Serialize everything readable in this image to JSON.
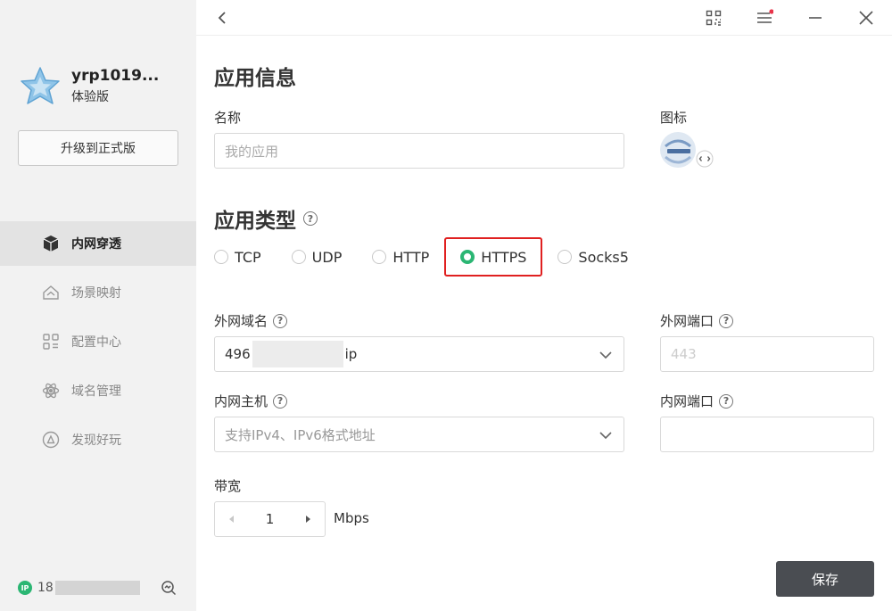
{
  "sidebar": {
    "profile": {
      "username": "yrp1019...",
      "edition": "体验版"
    },
    "upgrade_label": "升级到正式版",
    "items": [
      {
        "label": "内网穿透",
        "icon": "cube-icon",
        "active": true
      },
      {
        "label": "场景映射",
        "icon": "house-icon",
        "active": false
      },
      {
        "label": "配置中心",
        "icon": "grid-icon",
        "active": false
      },
      {
        "label": "域名管理",
        "icon": "atom-icon",
        "active": false
      },
      {
        "label": "发现好玩",
        "icon": "discover-icon",
        "active": false
      }
    ],
    "footer": {
      "ip_badge": "IP",
      "ip_prefix": "18"
    }
  },
  "topbar": {
    "icons": [
      "back-icon",
      "qr-code-icon",
      "menu-icon",
      "minimize-icon",
      "close-icon"
    ],
    "notification_dot_color": "#e8334a"
  },
  "app_info": {
    "title": "应用信息",
    "name_label": "名称",
    "name_placeholder": "我的应用",
    "icon_label": "图标"
  },
  "app_type": {
    "title": "应用类型",
    "help": "?",
    "options": [
      "TCP",
      "UDP",
      "HTTP",
      "HTTPS",
      "Socks5"
    ],
    "selected": "HTTPS"
  },
  "fields": {
    "external_domain": {
      "label": "外网域名",
      "value_prefix": "496",
      "value_suffix": "ip"
    },
    "external_port": {
      "label": "外网端口",
      "placeholder": "443"
    },
    "internal_host": {
      "label": "内网主机",
      "placeholder": "支持IPv4、IPv6格式地址"
    },
    "internal_port": {
      "label": "内网端口",
      "value": ""
    },
    "bandwidth": {
      "label": "带宽",
      "value": "1",
      "unit": "Mbps"
    }
  },
  "save_label": "保存",
  "colors": {
    "accent": "#2bb673",
    "highlight": "#e02020",
    "save_button": "#4a4d52"
  }
}
